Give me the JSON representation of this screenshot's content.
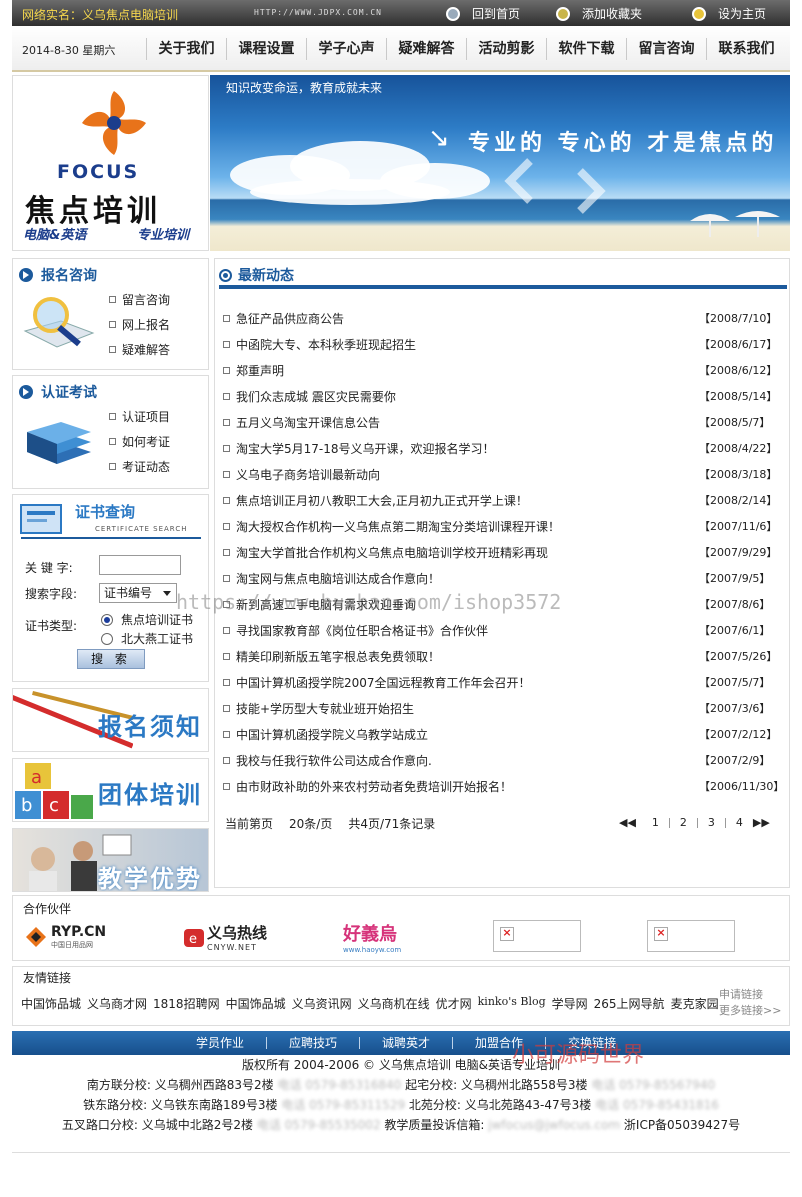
{
  "topbar": {
    "realname": "网络实名：义乌焦点电脑培训",
    "url": "HTTP://WWW.JDPX.COM.CN",
    "links": [
      "回到首页",
      "添加收藏夹",
      "设为主页"
    ]
  },
  "nav": {
    "date": "2014-8-30 星期六",
    "items": [
      "关于我们",
      "课程设置",
      "学子心声",
      "疑难解答",
      "活动剪影",
      "软件下载",
      "留言咨询",
      "联系我们"
    ]
  },
  "logo": {
    "focus": "FOCUS",
    "name": "焦点培训",
    "sub1": "电脑&英语",
    "sub2": "专业培训"
  },
  "banner": {
    "slogan": "知识改变命运，教育成就未来",
    "tagline": "专业的 专心的 才是焦点的"
  },
  "signup": {
    "title": "报名咨询",
    "links": [
      "留言咨询",
      "网上报名",
      "疑难解答"
    ]
  },
  "exam": {
    "title": "认证考试",
    "links": [
      "认证项目",
      "如何考证",
      "考证动态"
    ]
  },
  "cert": {
    "title": "证书查询",
    "title_en": "CERTIFICATE  SEARCH",
    "keyword_label": "关 键 字:",
    "field_label": "搜索字段:",
    "field_value": "证书编号",
    "type_label": "证书类型:",
    "type_options": [
      "焦点培训证书",
      "北大燕工证书"
    ],
    "search_button": "搜 索"
  },
  "promos": [
    "报名须知",
    "团体培训",
    "教学优势"
  ],
  "news": {
    "title": "最新动态",
    "items": [
      {
        "title": "急征产品供应商公告",
        "date": "【2008/7/10】"
      },
      {
        "title": "中函院大专、本科秋季班现起招生",
        "date": "【2008/6/17】"
      },
      {
        "title": "郑重声明",
        "date": "【2008/6/12】"
      },
      {
        "title": "我们众志成城 震区灾民需要你",
        "date": "【2008/5/14】"
      },
      {
        "title": "五月义乌淘宝开课信息公告",
        "date": "【2008/5/7】"
      },
      {
        "title": "淘宝大学5月17-18号义乌开课，欢迎报名学习！",
        "date": "【2008/4/22】"
      },
      {
        "title": "义乌电子商务培训最新动向",
        "date": "【2008/3/18】"
      },
      {
        "title": "焦点培训正月初八教职工大会,正月初九正式开学上课！",
        "date": "【2008/2/14】"
      },
      {
        "title": "淘大授权合作机构一义乌焦点第二期淘宝分类培训课程开课！",
        "date": "【2007/11/6】"
      },
      {
        "title": "淘宝大学首批合作机构义乌焦点电脑培训学校开班精彩再现",
        "date": "【2007/9/29】"
      },
      {
        "title": "淘宝网与焦点电脑培训达成合作意向！",
        "date": "【2007/9/5】"
      },
      {
        "title": "新到高速二手电脑有需求欢迎垂询",
        "date": "【2007/8/6】"
      },
      {
        "title": "寻找国家教育部《岗位任职合格证书》合作伙伴",
        "date": "【2007/6/1】"
      },
      {
        "title": "精美印刷新版五笔字根总表免费领取！",
        "date": "【2007/5/26】"
      },
      {
        "title": "中国计算机函授学院2007全国远程教育工作年会召开！",
        "date": "【2007/5/7】"
      },
      {
        "title": "技能+学历型大专就业班开始招生",
        "date": "【2007/3/6】"
      },
      {
        "title": "中国计算机函授学院义乌教学站成立",
        "date": "【2007/2/12】"
      },
      {
        "title": "我校与任我行软件公司达成合作意向.",
        "date": "【2007/2/9】"
      },
      {
        "title": "由市财政补助的外来农村劳动者免费培训开始报名！",
        "date": "【2006/11/30】"
      }
    ],
    "pager": {
      "current": "当前第页",
      "per_page": "20条/页",
      "total": "共4页/71条记录",
      "pages": [
        "1",
        "2",
        "3",
        "4"
      ]
    }
  },
  "watermark": "https://www.huzhan.com/ishop3572",
  "partners": {
    "title": "合作伙伴",
    "logo1": "RYP.CN",
    "logo1_sub": "中国日用品网",
    "logo2": "义乌热线",
    "logo2_sub": "CNYW.NET",
    "logo3": "好義烏",
    "logo3_sub": "www.haoyw.com"
  },
  "friends": {
    "title": "友情链接",
    "links": [
      "中国饰品城",
      "义乌商才网",
      "1818招聘网",
      "中国饰品城",
      "义乌资讯网",
      "义乌商机在线",
      "优才网",
      "kinko's Blog",
      "学导网",
      "265上网导航",
      "麦克家园"
    ],
    "apply": "申请链接",
    "more": "更多链接>>"
  },
  "footer": {
    "nav": [
      "学员作业",
      "应聘技巧",
      "诚聘英才",
      "加盟合作",
      "交换链接"
    ],
    "copyright": "版权所有 2004-2006 © 义乌焦点培训 电脑&英语专业培训",
    "line2a": "南方联分校: 义乌稠州西路83号2楼",
    "phone": "电话 0579-85316840",
    "line2b": "起宅分校: 义乌稠州北路558号3楼",
    "phone2": "电话 0579-85567940",
    "line3a": "铁东路分校: 义乌铁东南路189号3楼",
    "phone3": "电话 0579-85311529",
    "line3b": "北苑分校: 义乌北苑路43-47号3楼",
    "phone4": "电话 0579-85431816",
    "line4a": "五叉路口分校: 义乌城中北路2号2楼",
    "phone5": "电话 0579-85535002",
    "line4b": "教学质量投诉信箱:",
    "email": "jwfocus@jwfocus.com",
    "icp": "浙ICP备05039427号",
    "sitemark": "小可源码世界"
  },
  "colors": {
    "accent": "#1c5a9c",
    "topbar": "#3a3a3a",
    "highlight": "#f5d74e"
  }
}
